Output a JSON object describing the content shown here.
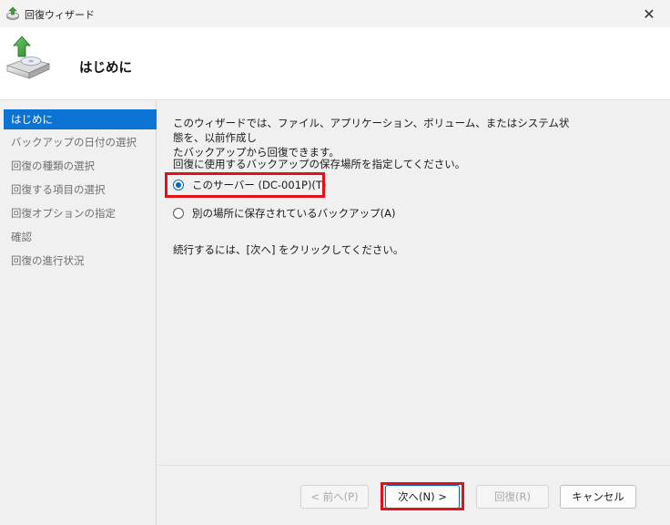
{
  "window": {
    "title": "回復ウィザード",
    "close_glyph": "✕"
  },
  "header": {
    "title": "はじめに",
    "icon": "backup-restore-icon"
  },
  "sidebar": {
    "steps": [
      {
        "label": "はじめに",
        "active": true
      },
      {
        "label": "バックアップの日付の選択",
        "active": false
      },
      {
        "label": "回復の種類の選択",
        "active": false
      },
      {
        "label": "回復する項目の選択",
        "active": false
      },
      {
        "label": "回復オプションの指定",
        "active": false
      },
      {
        "label": "確認",
        "active": false
      },
      {
        "label": "回復の進行状況",
        "active": false
      }
    ]
  },
  "content": {
    "intro_line1": "このウィザードでは、ファイル、アプリケーション、ボリューム、またはシステム状態を、以前作成し",
    "intro_line2": "たバックアップから回復できます。",
    "prompt": "回復に使用するバックアップの保存場所を指定してください。",
    "options": [
      {
        "label": "このサーバー (DC-001P)(T)",
        "checked": true
      },
      {
        "label": "別の場所に保存されているバックアップ(A)",
        "checked": false
      }
    ],
    "footnote": "続行するには、[次へ] をクリックしてください。"
  },
  "buttons": {
    "back": "< 前へ(P)",
    "next": "次へ(N) >",
    "recover": "回復(R)",
    "cancel": "キャンセル"
  },
  "colors": {
    "accent": "#0a73d3",
    "highlight": "#e0121a"
  }
}
